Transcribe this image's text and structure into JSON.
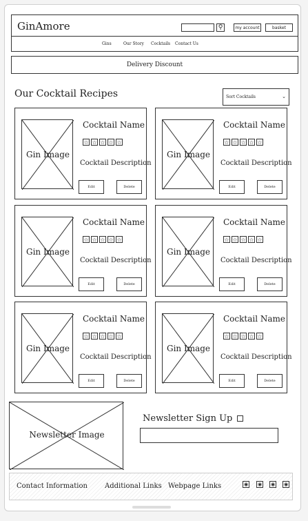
{
  "header": {
    "logo": "GinAmore",
    "search_icon": "search-icon",
    "account_label": "my account",
    "basket_label": "basket",
    "nav": [
      "Gins",
      "Our Story",
      "Cocktails",
      "Contact Us"
    ],
    "discount": "Delivery Discount"
  },
  "recipes": {
    "title": "Our Cocktail Recipes",
    "sort_label": "Sort Cocktails",
    "cards": [
      {
        "image": "Gin Image",
        "name": "Cocktail Name",
        "description": "Cocktail Description",
        "button1": "Edit",
        "button2": "Delete"
      },
      {
        "image": "Gin Image",
        "name": "Cocktail Name",
        "description": "Cocktail Description",
        "button1": "Edit",
        "button2": "Delete"
      },
      {
        "image": "Gin Image",
        "name": "Cocktail Name",
        "description": "Cocktail Description",
        "button1": "Edit",
        "button2": "Delete"
      },
      {
        "image": "Gin Image",
        "name": "Cocktail Name",
        "description": "Cocktail Description",
        "button1": "Edit",
        "button2": "Delete"
      },
      {
        "image": "Gin Image",
        "name": "Cocktail Name",
        "description": "Cocktail Description",
        "button1": "Edit",
        "button2": "Delete"
      },
      {
        "image": "Gin Image",
        "name": "Cocktail Name",
        "description": "Cocktail Description",
        "button1": "Edit",
        "button2": "Delete"
      }
    ]
  },
  "newsletter": {
    "image": "Newsletter Image",
    "title": "Newsletter Sign Up"
  },
  "footer": {
    "contact": "Contact Information",
    "additional": "Additional Links",
    "webpage": "Webpage Links",
    "social_icons": [
      "social-icon",
      "social-icon",
      "social-icon",
      "social-icon"
    ]
  }
}
